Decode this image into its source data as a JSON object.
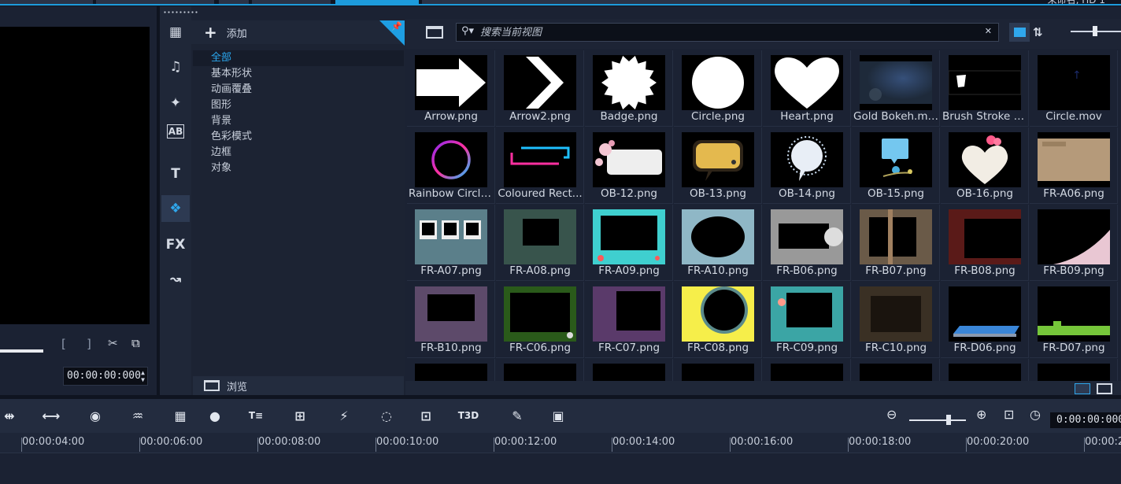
{
  "window": {
    "title": "未命名, HD 1"
  },
  "preview": {
    "timecode": "00:00:00:000"
  },
  "rail": {
    "items": [
      {
        "name": "rail-media-icon",
        "glyph": "▦"
      },
      {
        "name": "rail-audio-icon",
        "glyph": "♫"
      },
      {
        "name": "rail-instant-project-icon",
        "glyph": "✦"
      },
      {
        "name": "rail-transition-icon",
        "glyph": "AB"
      },
      {
        "name": "rail-title-icon",
        "glyph": "T"
      },
      {
        "name": "rail-graphics-icon",
        "glyph": "❖"
      },
      {
        "name": "rail-fx-icon",
        "glyph": "FX"
      },
      {
        "name": "rail-path-icon",
        "glyph": "↝"
      }
    ]
  },
  "categories": {
    "add_label": "添加",
    "items": [
      "全部",
      "基本形状",
      "动画覆叠",
      "图形",
      "背景",
      "色彩模式",
      "边框",
      "对象"
    ],
    "browse_label": "浏览"
  },
  "library": {
    "search_placeholder": "搜索当前视图",
    "items": [
      {
        "name": "Arrow.png",
        "kind": "arrow"
      },
      {
        "name": "Arrow2.png",
        "kind": "chevron"
      },
      {
        "name": "Badge.png",
        "kind": "badge"
      },
      {
        "name": "Circle.png",
        "kind": "circle"
      },
      {
        "name": "Heart.png",
        "kind": "heart"
      },
      {
        "name": "Gold Bokeh.mov",
        "kind": "bokeh"
      },
      {
        "name": "Brush Stroke 4 ...",
        "kind": "brush"
      },
      {
        "name": "Circle.mov",
        "kind": "circlemov"
      },
      {
        "name": "Rainbow Circle...",
        "kind": "rainbow"
      },
      {
        "name": "Coloured Rect...",
        "kind": "colrect"
      },
      {
        "name": "OB-12.png",
        "kind": "ob12"
      },
      {
        "name": "OB-13.png",
        "kind": "ob13"
      },
      {
        "name": "OB-14.png",
        "kind": "ob14"
      },
      {
        "name": "OB-15.png",
        "kind": "ob15"
      },
      {
        "name": "OB-16.png",
        "kind": "ob16"
      },
      {
        "name": "FR-A06.png",
        "kind": "fra06"
      },
      {
        "name": "FR-A07.png",
        "kind": "fra07"
      },
      {
        "name": "FR-A08.png",
        "kind": "fra08"
      },
      {
        "name": "FR-A09.png",
        "kind": "fra09"
      },
      {
        "name": "FR-A10.png",
        "kind": "fra10"
      },
      {
        "name": "FR-B06.png",
        "kind": "frb06"
      },
      {
        "name": "FR-B07.png",
        "kind": "frb07"
      },
      {
        "name": "FR-B08.png",
        "kind": "frb08"
      },
      {
        "name": "FR-B09.png",
        "kind": "frb09"
      },
      {
        "name": "FR-B10.png",
        "kind": "frb10"
      },
      {
        "name": "FR-C06.png",
        "kind": "frc06"
      },
      {
        "name": "FR-C07.png",
        "kind": "frc07"
      },
      {
        "name": "FR-C08.png",
        "kind": "frc08"
      },
      {
        "name": "FR-C09.png",
        "kind": "frc09"
      },
      {
        "name": "FR-C10.png",
        "kind": "frc10"
      },
      {
        "name": "FR-D06.png",
        "kind": "frd06"
      },
      {
        "name": "FR-D07.png",
        "kind": "frd07"
      },
      {
        "name": "",
        "kind": "blank"
      },
      {
        "name": "",
        "kind": "blank"
      },
      {
        "name": "",
        "kind": "blank"
      },
      {
        "name": "",
        "kind": "blank"
      },
      {
        "name": "",
        "kind": "blank"
      },
      {
        "name": "",
        "kind": "blank"
      },
      {
        "name": "",
        "kind": "blank"
      },
      {
        "name": "",
        "kind": "blank"
      }
    ]
  },
  "timeline": {
    "timecode": "0:00:00:000",
    "ruler": [
      "00:00:04:00",
      "00:00:06:00",
      "00:00:08:00",
      "00:00:10:00",
      "00:00:12:00",
      "00:00:14:00",
      "00:00:16:00",
      "00:00:18:00",
      "00:00:20:00",
      "00:00:2"
    ],
    "tools": [
      {
        "name": "split-icon",
        "glyph": "⇹"
      },
      {
        "name": "trim-icon",
        "glyph": "⟷"
      },
      {
        "name": "record-icon",
        "glyph": "◉"
      },
      {
        "name": "audio-mixer-icon",
        "glyph": "♒"
      },
      {
        "name": "multi-trim-icon",
        "glyph": "▦"
      },
      {
        "name": "color-icon",
        "glyph": "●"
      },
      {
        "name": "subtitle-icon",
        "glyph": "T≡"
      },
      {
        "name": "split-screen-icon",
        "glyph": "⊞"
      },
      {
        "name": "motion-icon",
        "glyph": "⚡"
      },
      {
        "name": "mask-icon",
        "glyph": "◌"
      },
      {
        "name": "pan-zoom-icon",
        "glyph": "⊡"
      },
      {
        "name": "title-3d-icon",
        "glyph": "T3D"
      },
      {
        "name": "auto-music-icon",
        "glyph": "✎"
      },
      {
        "name": "storyboard-icon",
        "glyph": "▣"
      }
    ]
  }
}
